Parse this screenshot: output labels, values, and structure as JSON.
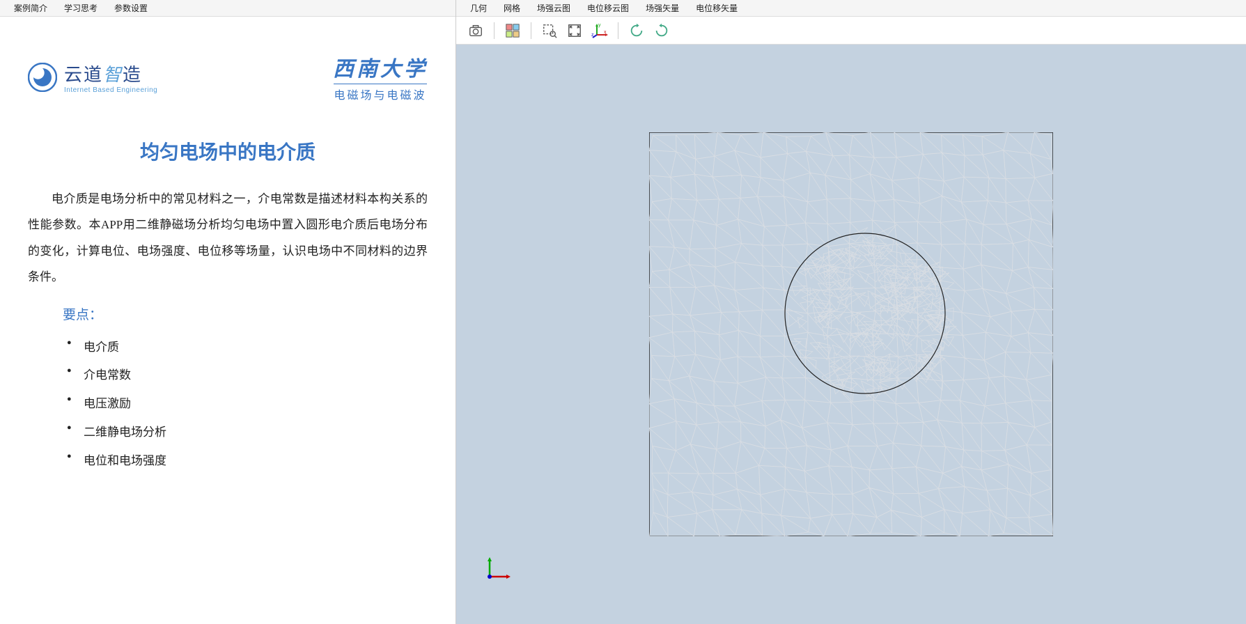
{
  "leftMenu": {
    "items": [
      {
        "label": "案例简介"
      },
      {
        "label": "学习思考"
      },
      {
        "label": "参数设置"
      }
    ]
  },
  "rightMenu": {
    "items": [
      {
        "label": "几何"
      },
      {
        "label": "网格"
      },
      {
        "label": "场强云图"
      },
      {
        "label": "电位移云图"
      },
      {
        "label": "场强矢量"
      },
      {
        "label": "电位移矢量"
      }
    ]
  },
  "logos": {
    "left": {
      "main": "云道",
      "smart": "智",
      "last": "造",
      "sub": "Internet Based Engineering"
    },
    "right": {
      "main": "西南大学",
      "sub": "电磁场与电磁波"
    }
  },
  "content": {
    "title": "均匀电场中的电介质",
    "paragraph": "电介质是电场分析中的常见材料之一，介电常数是描述材料本构关系的性能参数。本APP用二维静磁场分析均匀电场中置入圆形电介质后电场分布的变化，计算电位、电场强度、电位移等场量，认识电场中不同材料的边界条件。",
    "pointsTitle": "要点：",
    "points": [
      "电介质",
      "介电常数",
      "电压激励",
      "二维静电场分析",
      "电位和电场强度"
    ]
  },
  "toolbar": {
    "icons": [
      {
        "name": "camera-icon"
      },
      {
        "name": "select-mode-icon"
      },
      {
        "name": "zoom-box-icon"
      },
      {
        "name": "fit-extents-icon"
      },
      {
        "name": "axes-icon"
      },
      {
        "name": "rotate-cw-icon"
      },
      {
        "name": "rotate-ccw-icon"
      }
    ]
  }
}
